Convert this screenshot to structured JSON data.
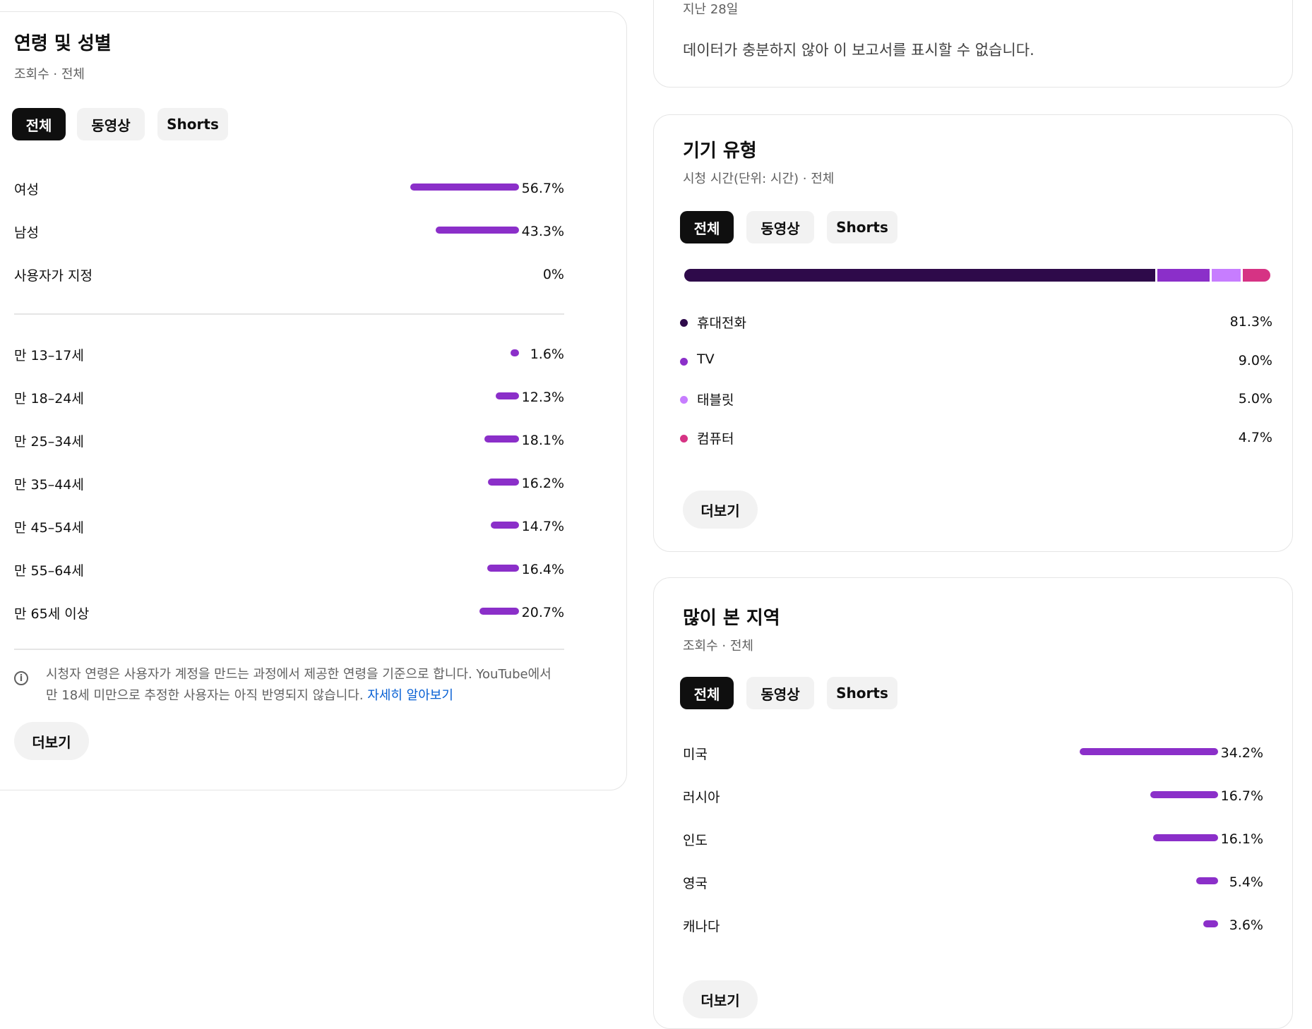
{
  "colors": {
    "bar": "#8b2fc9",
    "phone": "#2e0a4a",
    "tv": "#8b2fc9",
    "tablet": "#c77dff",
    "computer": "#d63384",
    "link": "#065fd4"
  },
  "age_gender": {
    "title": "연령 및 성별",
    "subtitle": "조회수 · 전체",
    "tabs": [
      "전체",
      "동영상",
      "Shorts"
    ],
    "gender": [
      {
        "label": "여성",
        "value": "56.7%",
        "pct": 56.7
      },
      {
        "label": "남성",
        "value": "43.3%",
        "pct": 43.3
      },
      {
        "label": "사용자가 지정",
        "value": "0%",
        "pct": 0
      }
    ],
    "ages": [
      {
        "label": "만 13–17세",
        "value": "1.6%",
        "pct": 1.6
      },
      {
        "label": "만 18–24세",
        "value": "12.3%",
        "pct": 12.3
      },
      {
        "label": "만 25–34세",
        "value": "18.1%",
        "pct": 18.1
      },
      {
        "label": "만 35–44세",
        "value": "16.2%",
        "pct": 16.2
      },
      {
        "label": "만 45–54세",
        "value": "14.7%",
        "pct": 14.7
      },
      {
        "label": "만 55–64세",
        "value": "16.4%",
        "pct": 16.4
      },
      {
        "label": "만 65세 이상",
        "value": "20.7%",
        "pct": 20.7
      }
    ],
    "note_text": "시청자 연령은 사용자가 계정을 만드는 과정에서 제공한 연령을 기준으로 합니다. YouTube에서 만 18세 미만으로 추정한 사용자는 아직 반영되지 않습니다. ",
    "note_link": "자세히 알아보기",
    "more": "더보기"
  },
  "notice": {
    "period": "지난 28일",
    "message": "데이터가 충분하지 않아 이 보고서를 표시할 수 없습니다."
  },
  "device": {
    "title": "기기 유형",
    "subtitle": "시청 시간(단위: 시간) · 전체",
    "tabs": [
      "전체",
      "동영상",
      "Shorts"
    ],
    "items": [
      {
        "label": "휴대전화",
        "value": "81.3%",
        "pct": 81.3,
        "color": "#2e0a4a"
      },
      {
        "label": "TV",
        "value": "9.0%",
        "pct": 9.0,
        "color": "#8b2fc9"
      },
      {
        "label": "태블릿",
        "value": "5.0%",
        "pct": 5.0,
        "color": "#c77dff"
      },
      {
        "label": "컴퓨터",
        "value": "4.7%",
        "pct": 4.7,
        "color": "#d63384"
      }
    ],
    "more": "더보기"
  },
  "geo": {
    "title": "많이 본 지역",
    "subtitle": "조회수 · 전체",
    "tabs": [
      "전체",
      "동영상",
      "Shorts"
    ],
    "items": [
      {
        "label": "미국",
        "value": "34.2%",
        "pct": 34.2
      },
      {
        "label": "러시아",
        "value": "16.7%",
        "pct": 16.7
      },
      {
        "label": "인도",
        "value": "16.1%",
        "pct": 16.1
      },
      {
        "label": "영국",
        "value": "5.4%",
        "pct": 5.4
      },
      {
        "label": "캐나다",
        "value": "3.6%",
        "pct": 3.6
      }
    ],
    "more": "더보기"
  }
}
